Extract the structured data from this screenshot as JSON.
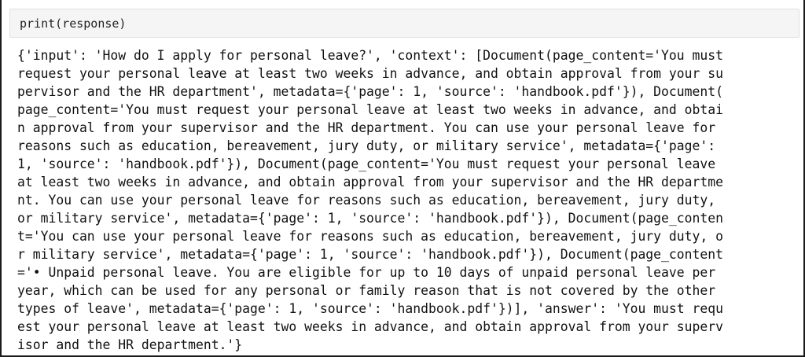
{
  "input_cell": {
    "code": "print(response)"
  },
  "output": {
    "lines": [
      "{'input': 'How do I apply for personal leave?', 'context': [Document(page_content='You must",
      "request your personal leave at least two weeks in advance, and obtain approval from your su",
      "pervisor and the HR department', metadata={'page': 1, 'source': 'handbook.pdf'}), Document(",
      "page_content='You must request your personal leave at least two weeks in advance, and obtai",
      "n approval from your supervisor and the HR department. You can use your personal leave for",
      "reasons such as education, bereavement, jury duty, or military service', metadata={'page':",
      "1, 'source': 'handbook.pdf'}), Document(page_content='You must request your personal leave",
      "at least two weeks in advance, and obtain approval from your supervisor and the HR departme",
      "nt. You can use your personal leave for reasons such as education, bereavement, jury duty,",
      "or military service', metadata={'page': 1, 'source': 'handbook.pdf'}), Document(page_conten",
      "t='You can use your personal leave for reasons such as education, bereavement, jury duty, o",
      "r military service', metadata={'page': 1, 'source': 'handbook.pdf'}), Document(page_content",
      "='• Unpaid personal leave. You are eligible for up to 10 days of unpaid personal leave per",
      "year, which can be used for any personal or family reason that is not covered by the other",
      "types of leave', metadata={'page': 1, 'source': 'handbook.pdf'})], 'answer': 'You must requ",
      "est your personal leave at least two weeks in advance, and obtain approval from your superv",
      "isor and the HR department.'}"
    ]
  }
}
